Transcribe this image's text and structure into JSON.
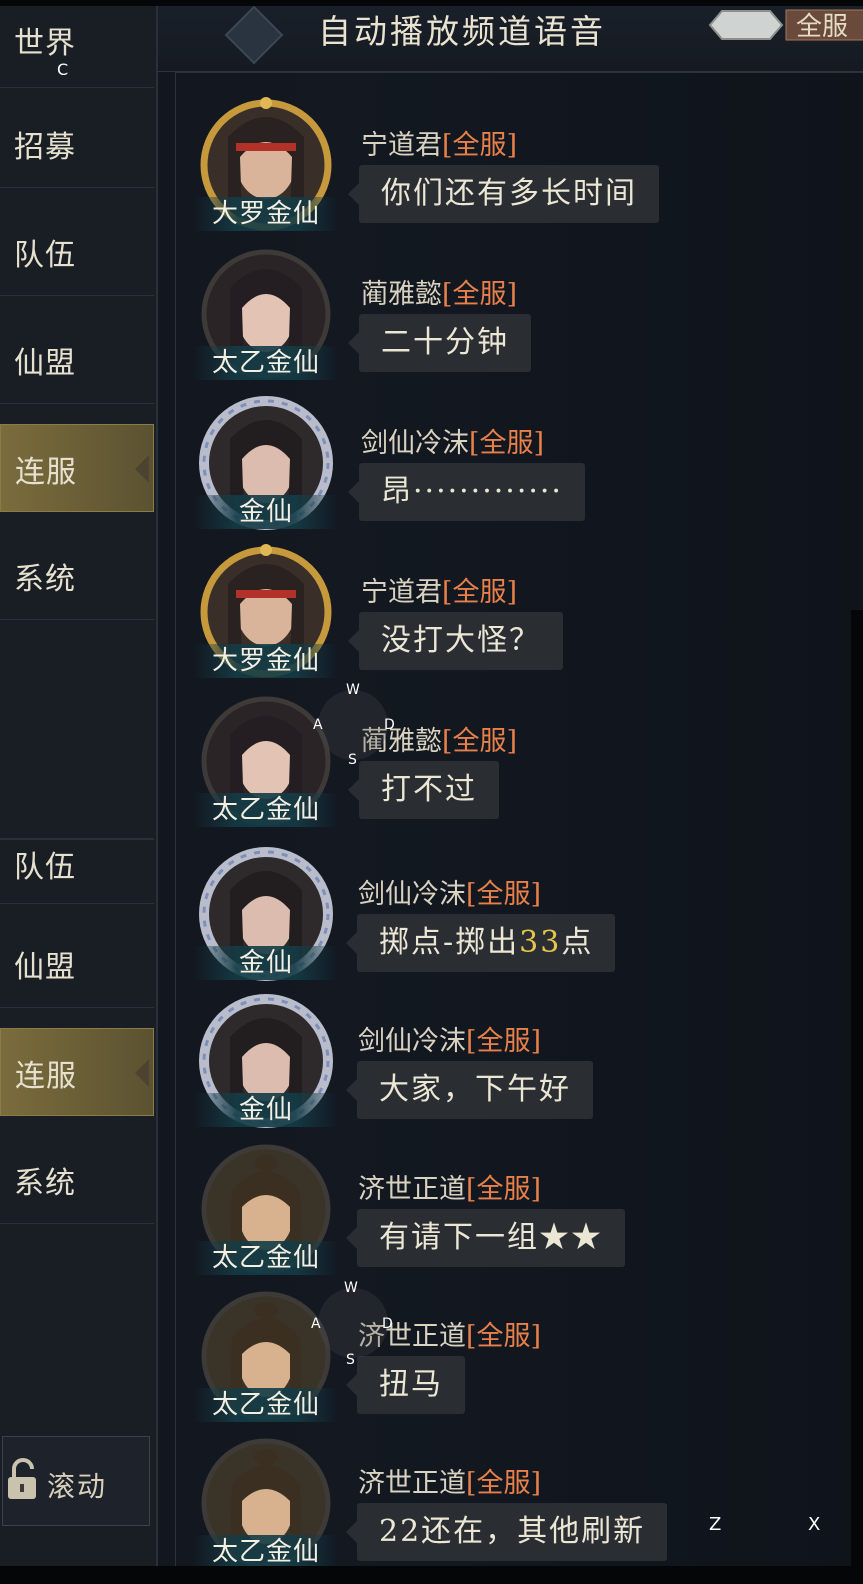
{
  "header": {
    "title": "自动播放频道语音",
    "scope_button_label": "全服"
  },
  "sidebar": {
    "items": [
      {
        "label": "世界",
        "active": false
      },
      {
        "label": "招募",
        "active": false
      },
      {
        "label": "队伍",
        "active": false
      },
      {
        "label": "仙盟",
        "active": false
      },
      {
        "label": "连服",
        "active": true
      },
      {
        "label": "系统",
        "active": false
      },
      {
        "label": "队伍",
        "active": false
      },
      {
        "label": "仙盟",
        "active": false
      },
      {
        "label": "连服",
        "active": true
      },
      {
        "label": "系统",
        "active": false
      }
    ],
    "scroll_button_label": "滚动"
  },
  "key_hints": {
    "c": "C",
    "w": "W",
    "a": "A",
    "s": "S",
    "d": "D",
    "z": "Z",
    "x": "X"
  },
  "messages": [
    {
      "name": "宁道君",
      "tag": "[全服]",
      "rank": "大罗金仙",
      "text": "你们还有多长时间",
      "frame": "gold",
      "portrait": "male-headband"
    },
    {
      "name": "蔺雅懿",
      "tag": "[全服]",
      "rank": "太乙金仙",
      "text": "二十分钟",
      "frame": "dark",
      "portrait": "female"
    },
    {
      "name": "剑仙冷沫",
      "tag": "[全服]",
      "rank": "金仙",
      "text": "昂·············",
      "frame": "silver",
      "portrait": "female-dark"
    },
    {
      "name": "宁道君",
      "tag": "[全服]",
      "rank": "大罗金仙",
      "text": "没打大怪？",
      "frame": "gold",
      "portrait": "male-headband"
    },
    {
      "name": "蔺雅懿",
      "tag": "[全服]",
      "rank": "太乙金仙",
      "text": "打不过",
      "frame": "dark",
      "portrait": "female"
    },
    {
      "name": "剑仙冷沫",
      "tag": "[全服]",
      "rank": "金仙",
      "text_before": "掷点-掷出",
      "text_number": "33",
      "text_after": "点",
      "frame": "silver",
      "portrait": "female-dark"
    },
    {
      "name": "剑仙冷沫",
      "tag": "[全服]",
      "rank": "金仙",
      "text": "大家，下午好",
      "frame": "silver",
      "portrait": "female-dark"
    },
    {
      "name": "济世正道",
      "tag": "[全服]",
      "rank": "太乙金仙",
      "text": "有请下一组★★",
      "frame": "dark",
      "portrait": "male-topknot"
    },
    {
      "name": "济世正道",
      "tag": "[全服]",
      "rank": "太乙金仙",
      "text": "扭马",
      "frame": "dark",
      "portrait": "male-topknot"
    },
    {
      "name": "济世正道",
      "tag": "[全服]",
      "rank": "太乙金仙",
      "text": "22还在，其他刷新",
      "frame": "dark",
      "portrait": "male-topknot"
    }
  ],
  "colors": {
    "name_tag": "#e8804a",
    "highlight_number": "#e5c54a",
    "active_tab": "#7a6c3c"
  }
}
